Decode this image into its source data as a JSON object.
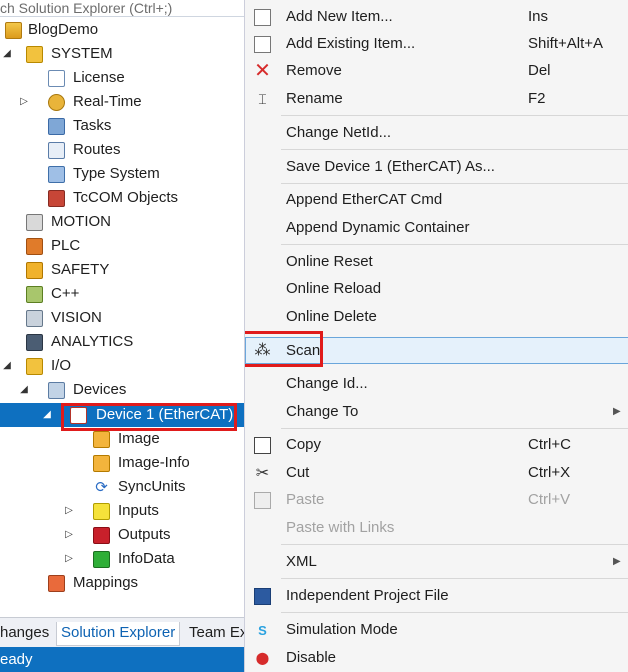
{
  "explorer": {
    "search_placeholder": "ch Solution Explorer (Ctrl+;)",
    "tree": [
      {
        "label": "BlogDemo"
      },
      {
        "label": "SYSTEM"
      },
      {
        "label": "License"
      },
      {
        "label": "Real-Time"
      },
      {
        "label": "Tasks"
      },
      {
        "label": "Routes"
      },
      {
        "label": "Type System"
      },
      {
        "label": "TcCOM Objects"
      },
      {
        "label": "MOTION"
      },
      {
        "label": "PLC"
      },
      {
        "label": "SAFETY"
      },
      {
        "label": "C++"
      },
      {
        "label": "VISION"
      },
      {
        "label": "ANALYTICS"
      },
      {
        "label": "I/O"
      },
      {
        "label": "Devices"
      },
      {
        "label": "Device 1 (EtherCAT)"
      },
      {
        "label": "Image"
      },
      {
        "label": "Image-Info"
      },
      {
        "label": "SyncUnits"
      },
      {
        "label": "Inputs"
      },
      {
        "label": "Outputs"
      },
      {
        "label": "InfoData"
      },
      {
        "label": "Mappings"
      }
    ],
    "bottom_tabs": [
      "hanges",
      "Solution Explorer",
      "Team Ex"
    ],
    "status": "eady"
  },
  "menu": {
    "items": [
      {
        "label": "Add New Item...",
        "shortcut": "Ins"
      },
      {
        "label": "Add Existing Item...",
        "shortcut": "Shift+Alt+A"
      },
      {
        "label": "Remove",
        "shortcut": "Del"
      },
      {
        "label": "Rename",
        "shortcut": "F2"
      },
      {
        "label": "Change NetId...",
        "shortcut": ""
      },
      {
        "label": "Save Device 1 (EtherCAT) As...",
        "shortcut": ""
      },
      {
        "label": "Append EtherCAT Cmd",
        "shortcut": ""
      },
      {
        "label": "Append Dynamic Container",
        "shortcut": ""
      },
      {
        "label": "Online Reset",
        "shortcut": ""
      },
      {
        "label": "Online Reload",
        "shortcut": ""
      },
      {
        "label": "Online Delete",
        "shortcut": ""
      },
      {
        "label": "Scan",
        "shortcut": ""
      },
      {
        "label": "Change Id...",
        "shortcut": ""
      },
      {
        "label": "Change To",
        "shortcut": ""
      },
      {
        "label": "Copy",
        "shortcut": "Ctrl+C"
      },
      {
        "label": "Cut",
        "shortcut": "Ctrl+X"
      },
      {
        "label": "Paste",
        "shortcut": "Ctrl+V"
      },
      {
        "label": "Paste with Links",
        "shortcut": ""
      },
      {
        "label": "XML",
        "shortcut": ""
      },
      {
        "label": "Independent Project File",
        "shortcut": ""
      },
      {
        "label": "Simulation Mode",
        "shortcut": ""
      },
      {
        "label": "Disable",
        "shortcut": ""
      }
    ]
  },
  "colors": {
    "selection": "#0e70c0",
    "highlight_border": "#e01b1b",
    "menu_bg": "#f5f5f5",
    "hover_bg": "#e5f1fb"
  }
}
